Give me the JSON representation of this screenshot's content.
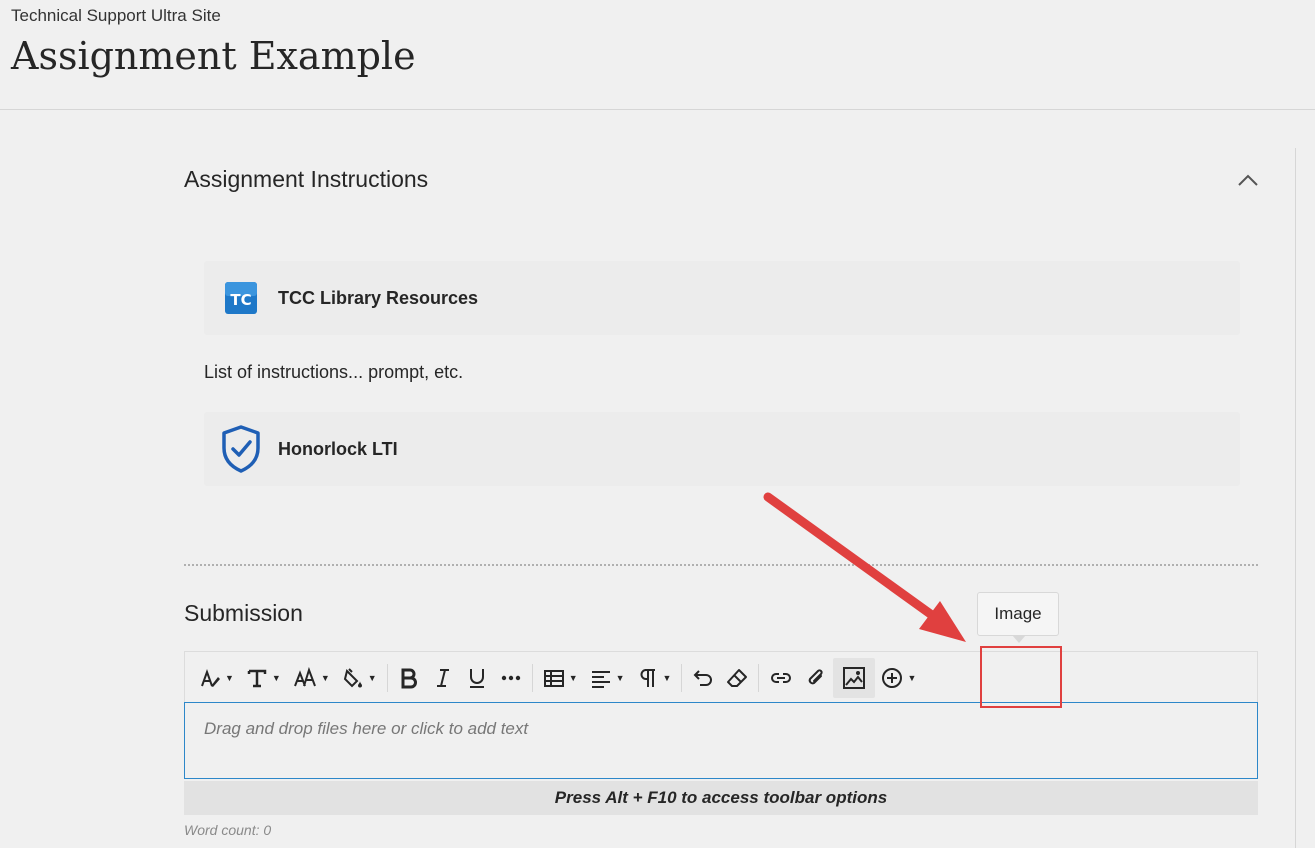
{
  "header": {
    "course_name": "Technical Support Ultra Site",
    "title": "Assignment Example"
  },
  "instructions": {
    "title": "Assignment Instructions",
    "items": [
      {
        "label": "TCC Library Resources",
        "icon": "tcc-logo-icon"
      },
      {
        "label": "Honorlock LTI",
        "icon": "shield-check-icon"
      }
    ],
    "text": "List of instructions... prompt, etc."
  },
  "submission": {
    "title": "Submission",
    "placeholder": "Drag and drop files here or click to add text",
    "hint": "Press Alt + F10 to access toolbar options",
    "word_count": "Word count: 0",
    "tooltip": "Image"
  },
  "toolbar": {
    "buttons": [
      "paragraph-style",
      "font-family",
      "font-size",
      "text-color",
      "bold",
      "italic",
      "underline",
      "more",
      "table",
      "align",
      "formatting",
      "undo",
      "clear-formatting",
      "link",
      "attach",
      "image",
      "add-content"
    ]
  },
  "colors": {
    "accent_blue": "#2d87c9",
    "annotation_red": "#e0403f",
    "shield_blue": "#1f5fb5"
  }
}
